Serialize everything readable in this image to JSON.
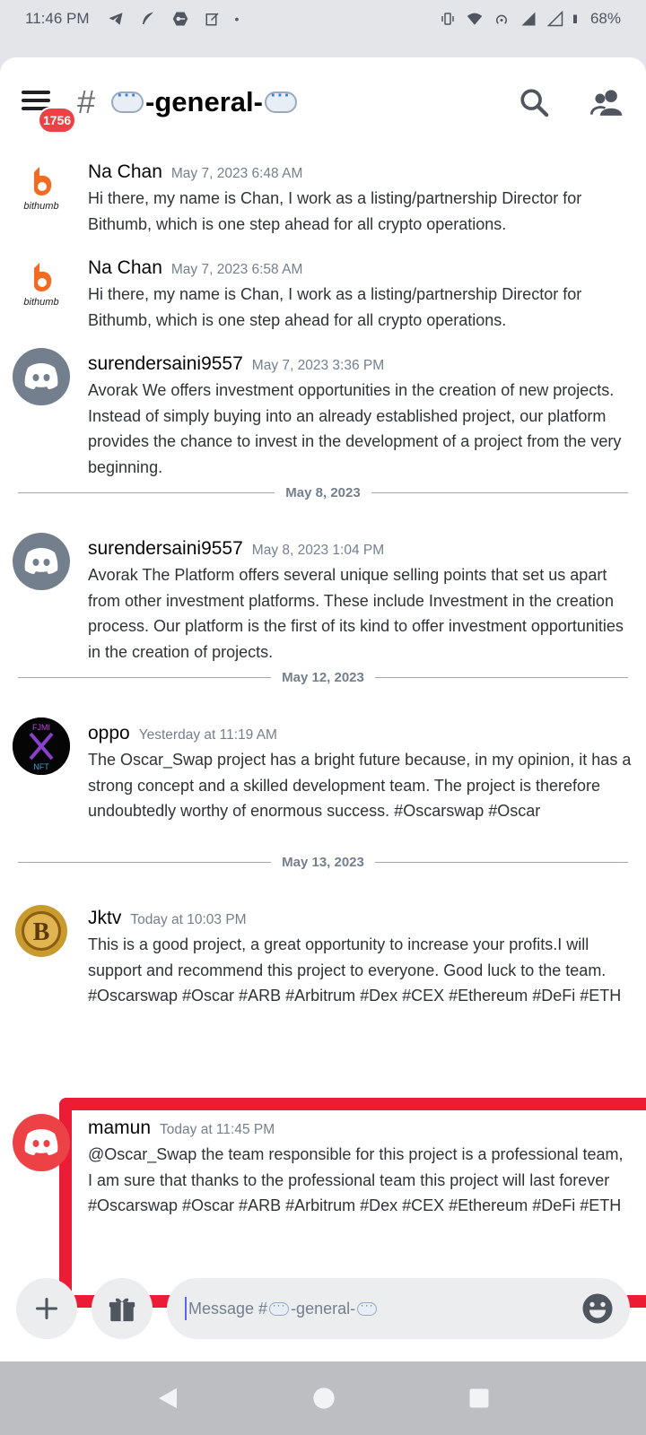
{
  "status_bar": {
    "time": "11:46 PM",
    "battery": "68%"
  },
  "header": {
    "badge_count": "1756",
    "channel_prefix": "-general-"
  },
  "messages": [
    {
      "author": "Na Chan",
      "timestamp": "May 7, 2023 6:48 AM",
      "lines": [
        "Hi there, my name is Chan, I work as a listing/partnership Director for Bithumb, which is one step ahead for all crypto operations."
      ],
      "avatar": "bithumb-logo"
    },
    {
      "author": "Na Chan",
      "timestamp": "May 7, 2023 6:58 AM",
      "lines": [
        "Hi there, my name is Chan, I work as a listing/partnership Director for Bithumb, which is one step ahead for all crypto operations."
      ],
      "avatar": "bithumb-logo"
    },
    {
      "author": "surendersaini9557",
      "timestamp": "May 7, 2023 3:36 PM",
      "lines": [
        "Avorak We offers investment opportunities in the creation of new projects. Instead of simply buying into an already established project, our platform provides the chance to invest in the development of a project from the very beginning."
      ],
      "avatar": "discord-default-grey"
    },
    {
      "author": "surendersaini9557",
      "timestamp": "May 8, 2023 1:04 PM",
      "lines": [
        "Avorak The Platform offers several unique selling points that set us apart from other investment platforms. These include Investment in the creation process. Our platform is the first of its kind to offer investment opportunities in the creation of projects."
      ],
      "avatar": "discord-default-grey"
    },
    {
      "author": "oppo",
      "timestamp": "Yesterday at 11:19 AM",
      "lines": [
        "The Oscar_Swap project has a bright future because, in my opinion, it has a strong concept and a skilled development team. The project is therefore undoubtedly worthy of enormous success. #Oscarswap #Oscar"
      ],
      "avatar": "oppo-avatar"
    },
    {
      "author": "Jktv",
      "timestamp": "Today at 10:03 PM",
      "lines": [
        "This is a good project, a great opportunity to increase your profits.I will support and recommend this project to everyone. Good luck to the team.",
        "#Oscarswap #Oscar #ARB #Arbitrum #Dex #CEX #Ethereum #DeFi #ETH"
      ],
      "avatar": "bitcoin-coin"
    },
    {
      "author": "mamun",
      "timestamp": "Today at 11:45 PM",
      "lines": [
        "@Oscar_Swap the team responsible for this project is a professional team, I am sure that thanks to the professional team this project will last forever",
        "#Oscarswap #Oscar #ARB #Arbitrum #Dex #CEX #Ethereum #DeFi #ETH"
      ],
      "avatar": "discord-default-red"
    }
  ],
  "dividers": [
    "May 8, 2023",
    "May 12, 2023",
    "May 13, 2023"
  ],
  "composer": {
    "placeholder_prefix": "Message #",
    "placeholder_channel": "-general-"
  },
  "colors": {
    "accent": "#5865f2",
    "highlight": "#ed1c36",
    "badge": "#ed4245"
  }
}
